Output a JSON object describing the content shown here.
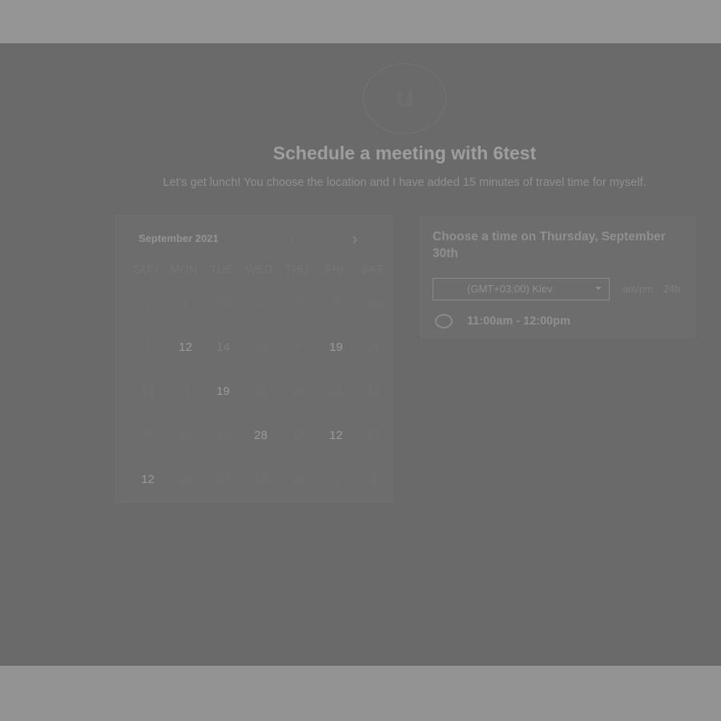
{
  "header": {
    "avatar_initial": "u",
    "title": "Schedule a meeting with 6test",
    "description": "Let's get lunch! You choose the location and I have added 15 minutes of travel time for myself."
  },
  "calendar": {
    "month_label": "September 2021",
    "prev_icon": "chevron-left-icon",
    "next_icon": "chevron-right-icon",
    "prev_glyph": "‹",
    "next_glyph": "›",
    "weekdays": [
      "SUN",
      "MON",
      "TUE",
      "WED",
      "THU",
      "FRI",
      "SAT"
    ],
    "weeks": [
      [
        "1",
        "2",
        "30",
        "1",
        "2",
        "3",
        "10"
      ],
      [
        "7",
        "12",
        "14",
        "15",
        "7",
        "19",
        "21"
      ],
      [
        "13",
        "4",
        "19",
        "11",
        "26",
        "22",
        "14"
      ],
      [
        "9",
        "30",
        "30",
        "28",
        "15",
        "12",
        "15"
      ],
      [
        "12",
        "25",
        "27",
        "13",
        "23",
        "8",
        "1"
      ]
    ]
  },
  "time_panel": {
    "heading": "Choose a time on Thursday, September 30th",
    "timezone": "(GMT+03:00) Kiev",
    "format_ampm": "am/pm",
    "format_24h": "24h",
    "slots": [
      "11:00am - 12:00pm"
    ]
  },
  "colors": {
    "overlay": "#6a6a6a",
    "frame": "#949494"
  }
}
